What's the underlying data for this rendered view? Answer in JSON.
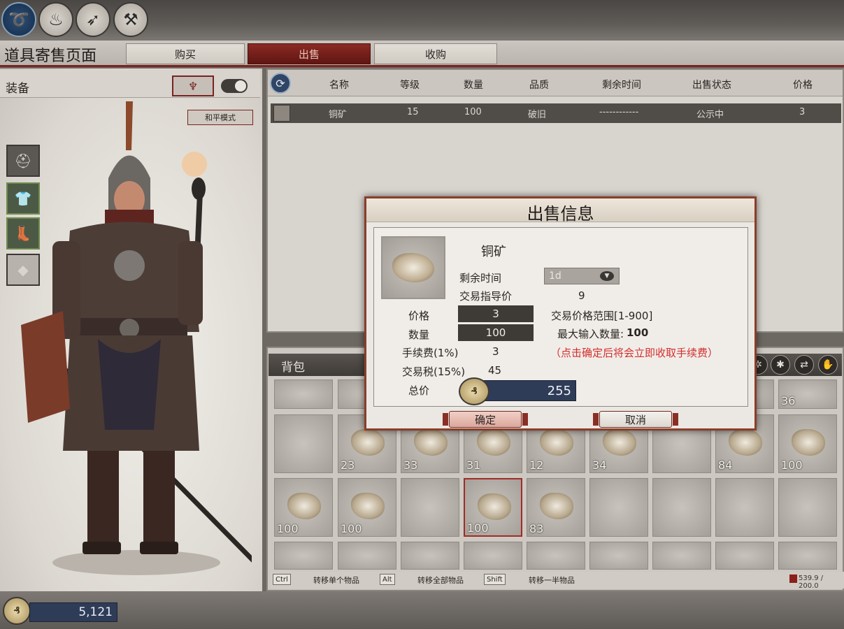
{
  "top_icons": [
    "horse-saddle-icon",
    "campfire-icon",
    "crossbow-icon",
    "anvil-icon"
  ],
  "page_title": "道具寄售页面",
  "tabs": {
    "buy": "购买",
    "sell": "出售",
    "acquire": "收购"
  },
  "left": {
    "equip_label": "装备",
    "peace_mode": "和平模式"
  },
  "money": "5,121",
  "coin_glyph": "₰",
  "list": {
    "headers": [
      "名称",
      "等级",
      "数量",
      "品质",
      "剩余时间",
      "出售状态",
      "价格"
    ],
    "rows": [
      {
        "name": "铜矿",
        "level": "15",
        "qty": "100",
        "quality": "破旧",
        "time": "------------",
        "status": "公示中",
        "price": "3"
      }
    ]
  },
  "bag": {
    "title": "背包",
    "row1_counts": [
      "",
      "",
      "",
      "",
      "",
      "",
      "",
      "",
      "36"
    ],
    "row2_counts": [
      "",
      "23",
      "33",
      "31",
      "12",
      "34",
      "",
      "84",
      "100"
    ],
    "row3_counts": [
      "100",
      "100",
      "",
      "100",
      "83",
      "",
      "",
      "",
      ""
    ],
    "hints": {
      "ctrl": "Ctrl",
      "ctrl_text": "转移单个物品",
      "alt": "Alt",
      "alt_text": "转移全部物品",
      "shift": "Shift",
      "shift_text": "转移一半物品"
    },
    "weight": "539.9 / 200.0"
  },
  "dialog": {
    "title": "出售信息",
    "item_name": "铜矿",
    "remaining_time_label": "剩余时间",
    "remaining_time_value": "1d",
    "guide_price_label": "交易指导价",
    "guide_price_value": "9",
    "price_label": "价格",
    "price_value": "3",
    "price_range": "交易价格范围[1-900]",
    "qty_label": "数量",
    "qty_value": "100",
    "max_qty_label": "最大输入数量:",
    "max_qty_value": "100",
    "fee_label": "手续费(1%)",
    "fee_value": "3",
    "fee_warning": "（点击确定后将会立即收取手续费）",
    "tax_label": "交易税(15%)",
    "tax_value": "45",
    "total_label": "总价",
    "total_value": "255",
    "confirm": "确定",
    "cancel": "取消"
  }
}
